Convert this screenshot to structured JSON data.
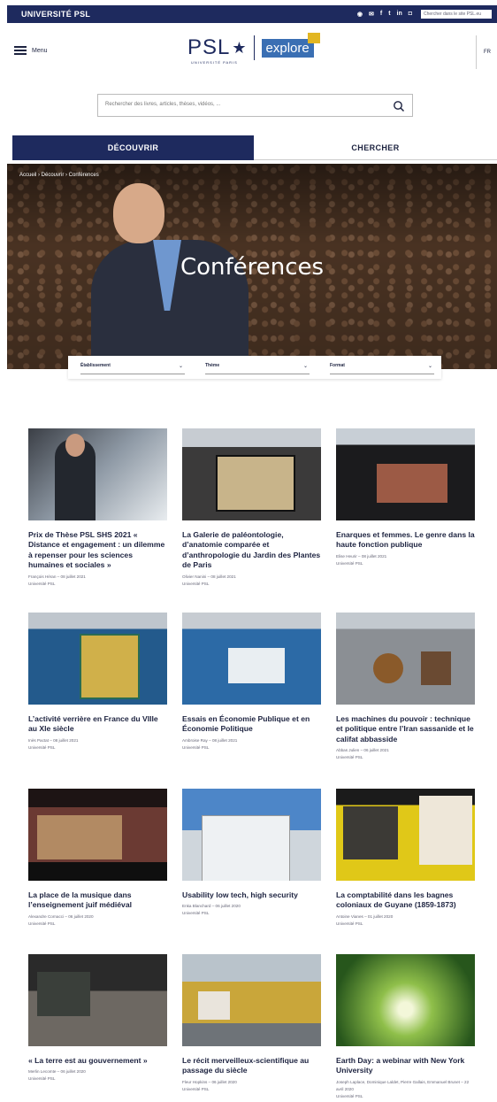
{
  "topbar": {
    "brand": "UNIVERSITÉ PSL",
    "social": [
      "rss",
      "mail",
      "f",
      "tw",
      "in",
      "ig"
    ],
    "search_placeholder": "Chercher dans le site PSL.eu"
  },
  "header": {
    "menu_label": "Menu",
    "logo_psl": "PSL",
    "logo_univ": "UNIVERSITÉ PARIS",
    "logo_explore": "explore",
    "lang": "FR"
  },
  "search": {
    "placeholder": "Rechercher des livres, articles, thèses, vidéos, ..."
  },
  "tabs": [
    "DÉCOUVRIR",
    "CHERCHER"
  ],
  "hero": {
    "breadcrumb": "Accueil › Découvrir › Conférences",
    "title": "Conférences"
  },
  "filters": [
    "Établissement",
    "Thème",
    "Format"
  ],
  "cards": [
    {
      "title": "Prix de Thèse PSL SHS 2021 « Distance et engagement : un dilemme à repenser pour les sciences humaines et sociales »",
      "author": "François Héran – 08 juillet 2021",
      "org": "Université PSL"
    },
    {
      "title": "La Galerie de paléontologie, d’anatomie comparée et d’anthropologie du Jardin des Plantes de Paris",
      "author": "Olivier Nanini – 08 juillet 2021",
      "org": "Université PSL"
    },
    {
      "title": "Enarques et femmes. Le genre dans la haute fonction publique",
      "author": "Elise Heurir – 08 juillet 2021",
      "org": "Université PSL"
    },
    {
      "title": "L’activité verrière en France du VIIIe au XIe siècle",
      "author": "Inès Pactat – 08 juillet 2021",
      "org": "Université PSL"
    },
    {
      "title": "Essais en Économie Publique et en Économie Politique",
      "author": "Ambroise Ray – 08 juillet 2021",
      "org": "Université PSL"
    },
    {
      "title": "Les machines du pouvoir : technique et politique entre l’Iran sassanide et le califat abbasside",
      "author": "Abbas Julien – 06 juillet 2021",
      "org": "Université PSL"
    },
    {
      "title": "La place de la musique dans l’enseignement juif médiéval",
      "author": "Alexandre Cornacci – 06 juillet 2020",
      "org": "Université PSL"
    },
    {
      "title": "Usability low tech, high security",
      "author": "Enka Blanchard – 06 juillet 2020",
      "org": "Université PSL"
    },
    {
      "title": "La comptabilité dans les bagnes coloniaux de Guyane (1859-1873)",
      "author": "Antoine Vianes – 01 juillet 2020",
      "org": "Université PSL"
    },
    {
      "title": "« La terre est au gouvernement »",
      "author": "Merlin Lecomte – 06 juillet 2020",
      "org": "Université PSL"
    },
    {
      "title": "Le récit merveilleux-scientifique au passage du siècle",
      "author": "Fleur Hopkins – 06 juillet 2020",
      "org": "Université PSL"
    },
    {
      "title": "Earth Day: a webinar with New York University",
      "author": "Joseph Laplace, Dominique Laldet, Pierre Gallais, Emmanuel Brunet – 22 avril 2020",
      "org": "Université PSL"
    }
  ],
  "colors": {
    "navy": "#1e2a5e",
    "accent_blue": "#3a6fb3"
  }
}
